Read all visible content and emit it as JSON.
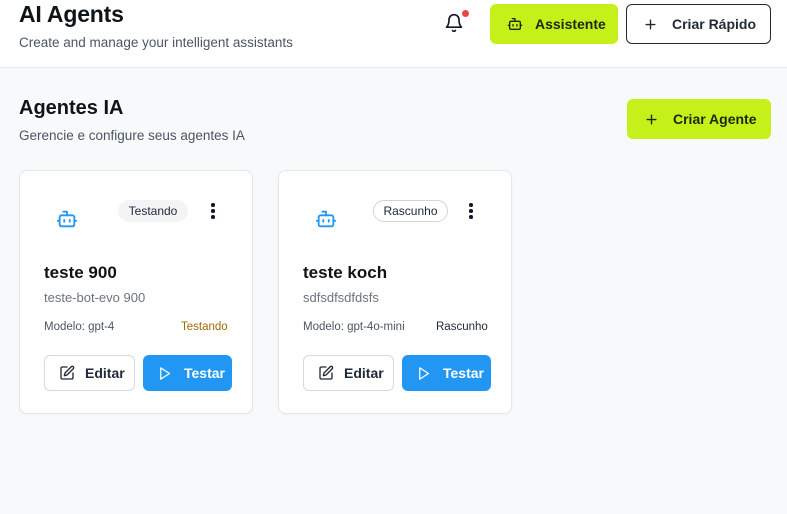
{
  "header": {
    "title": "AI Agents",
    "subtitle": "Create and manage your intelligent assistants",
    "assistant_label": "Assistente",
    "quick_create_label": "Criar Rápido"
  },
  "section": {
    "title": "Agentes IA",
    "subtitle": "Gerencie e configure seus agentes IA",
    "create_label": "Criar Agente"
  },
  "agents": [
    {
      "name": "teste 900",
      "description": "teste-bot-evo 900",
      "badge": "Testando",
      "model": "Modelo: gpt-4",
      "status": "Testando",
      "edit_label": "Editar",
      "test_label": "Testar"
    },
    {
      "name": "teste koch",
      "description": "sdfsdfsdfdsfs",
      "badge": "Rascunho",
      "model": "Modelo: gpt-4o-mini",
      "status": "Rascunho",
      "edit_label": "Editar",
      "test_label": "Testar"
    }
  ],
  "colors": {
    "accent_lime": "#c6f01a",
    "primary_blue": "#2196f3",
    "notification_dot": "#ef4444",
    "status_testing": "#a06a0a"
  },
  "icons": {
    "notification": "bell-icon",
    "assistant": "bot-icon",
    "add": "plus-icon",
    "agent": "bot-icon",
    "menu": "kebab-icon",
    "edit": "edit-icon",
    "test": "play-icon"
  }
}
